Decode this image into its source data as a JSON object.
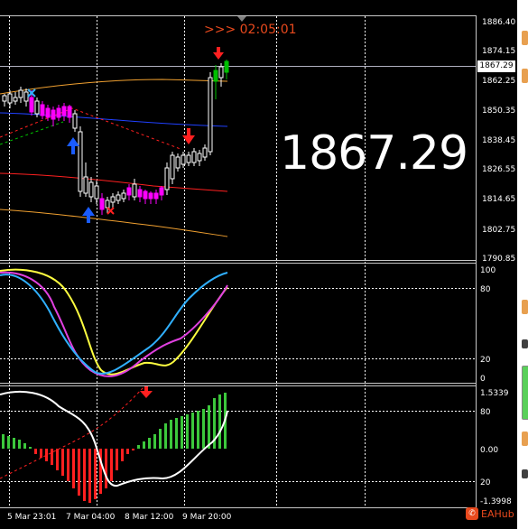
{
  "header": {
    "timer_text": ">>> 02:05:01",
    "big_price": "1867.29"
  },
  "price_axis": {
    "labels": [
      "1886.40",
      "1874.15",
      "1862.25",
      "1850.35",
      "1838.45",
      "1826.55",
      "1814.65",
      "1802.75",
      "1790.85"
    ],
    "current_price": "1867.29"
  },
  "stoch_axis": {
    "labels": [
      "100",
      "80",
      "20",
      "0"
    ]
  },
  "macd_axis": {
    "labels": [
      "1.5339",
      "80",
      "0.00",
      "20",
      "-1.3998"
    ]
  },
  "time_axis": {
    "labels": [
      "5 Mar 23:01",
      "7 Mar 04:00",
      "8 Mar 12:00",
      "9 Mar 20:00"
    ]
  },
  "watermark": {
    "text": "EAHub",
    "logo_glyph": "✆"
  },
  "colors": {
    "background": "#000000",
    "bull_candle": "#ffffff",
    "bear_candle": "#ff00ff",
    "candle_green": "#00c000",
    "orange_band": "#f0a030",
    "red_band": "#ff2020",
    "blue_line": "#2040ff",
    "arrow_down": "#ff2020",
    "arrow_up": "#1a5cff",
    "stoch_blue": "#30b0ff",
    "stoch_magenta": "#e040e0",
    "stoch_yellow": "#ffff40",
    "hist_green": "#3cc83c",
    "hist_red": "#ff2020",
    "macd_line": "#ffffff"
  }
}
